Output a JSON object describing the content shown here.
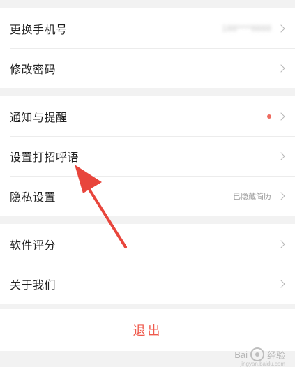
{
  "groups": [
    {
      "items": [
        {
          "label": "更换手机号",
          "value": "188****8888"
        },
        {
          "label": "修改密码"
        }
      ]
    },
    {
      "items": [
        {
          "label": "通知与提醒",
          "dot_color": "#ee6b5f"
        },
        {
          "label": "设置打招呼语"
        },
        {
          "label": "隐私设置",
          "value": "已隐藏简历"
        }
      ]
    },
    {
      "items": [
        {
          "label": "软件评分"
        },
        {
          "label": "关于我们"
        }
      ]
    }
  ],
  "logout_label": "退出",
  "watermark": {
    "brand": "Bai",
    "brand_suffix": "经验",
    "sub": "jingyan.baidu.com"
  },
  "colors": {
    "accent": "#ef5a4d",
    "arrow": "#e8453c",
    "background": "#f2f2f2"
  }
}
